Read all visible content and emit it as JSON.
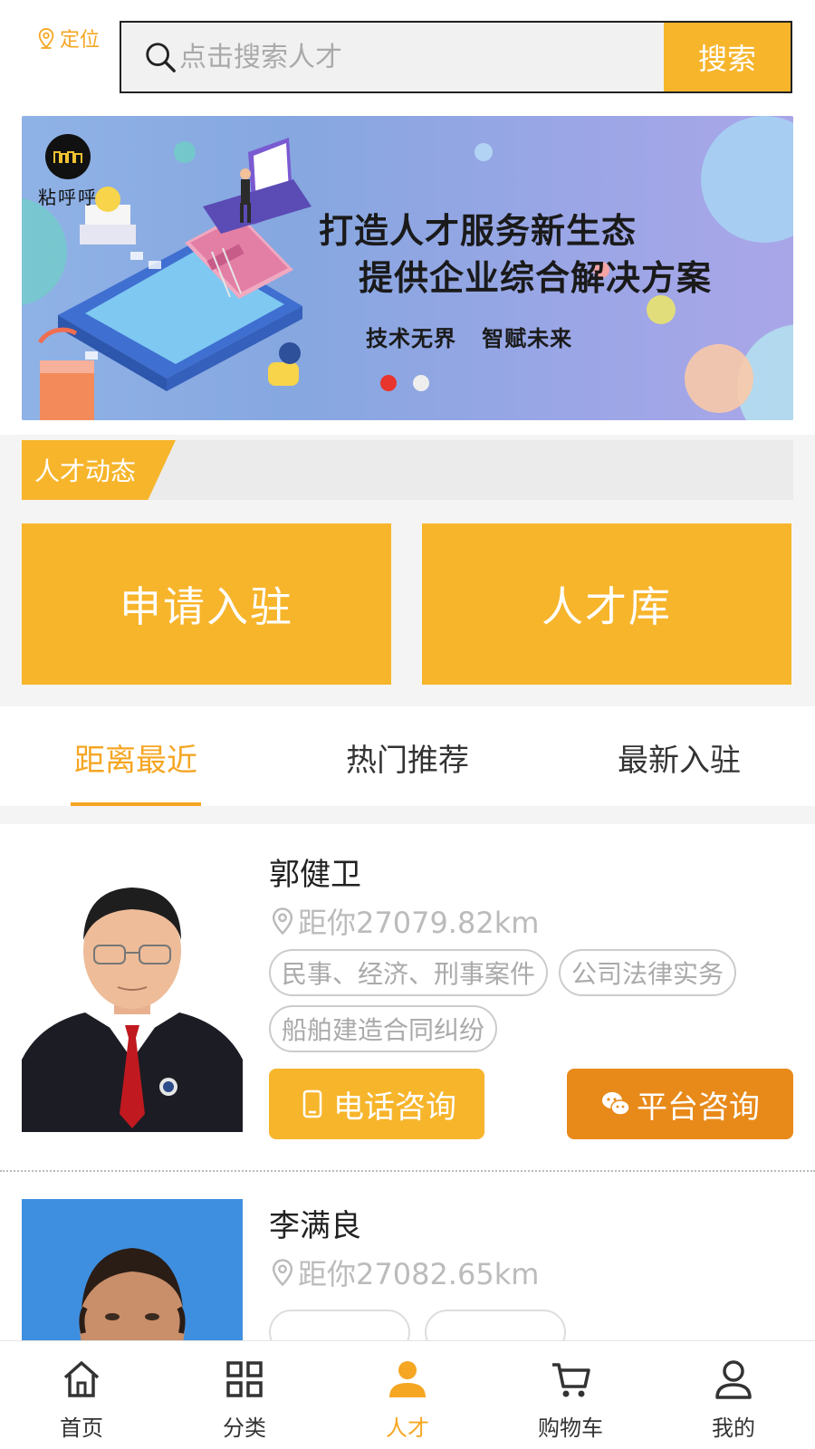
{
  "top": {
    "locate_label": "定位",
    "search_placeholder": "点击搜索人才",
    "search_button": "搜索"
  },
  "banner": {
    "logo_text": "粘呼呼",
    "headline1": "打造人才服务新生态",
    "headline2": "提供企业综合解决方案",
    "slogan": "技术无界   智赋未来",
    "slide_count": 2,
    "active_slide": 1
  },
  "section": {
    "title": "人才动态"
  },
  "actions": {
    "apply": "申请入驻",
    "library": "人才库"
  },
  "tabs": [
    {
      "label": "距离最近",
      "active": true
    },
    {
      "label": "热门推荐",
      "active": false
    },
    {
      "label": "最新入驻",
      "active": false
    }
  ],
  "talents": [
    {
      "name": "郭健卫",
      "distance": "距你27079.82km",
      "tags": [
        "民事、经济、刑事案件",
        "公司法律实务",
        "船舶建造合同纠纷"
      ],
      "phone_btn": "电话咨询",
      "chat_btn": "平台咨询"
    },
    {
      "name": "李满良",
      "distance": "距你27082.65km"
    }
  ],
  "nav": [
    {
      "label": "首页",
      "icon": "home-icon",
      "active": false
    },
    {
      "label": "分类",
      "icon": "grid-icon",
      "active": false
    },
    {
      "label": "人才",
      "icon": "person-icon",
      "active": true
    },
    {
      "label": "购物车",
      "icon": "cart-icon",
      "active": false
    },
    {
      "label": "我的",
      "icon": "user-icon",
      "active": false
    }
  ],
  "colors": {
    "accent": "#f7b52c",
    "chat": "#e88a1a",
    "dot_active": "#e8352d"
  }
}
